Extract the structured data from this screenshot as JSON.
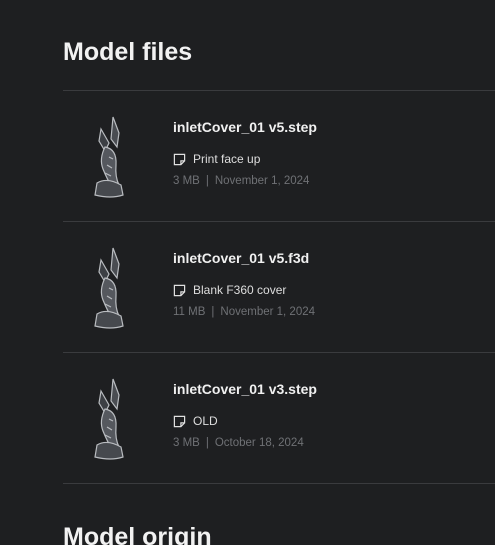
{
  "sections": {
    "files_title": "Model files",
    "origin_title": "Model origin"
  },
  "files": [
    {
      "name": "inletCover_01 v5.step",
      "note": "Print face up",
      "size": "3 MB",
      "separator": "|",
      "date": "November 1, 2024",
      "icon": "note-icon",
      "thumbnail": "model-thumbnail-icon"
    },
    {
      "name": "inletCover_01 v5.f3d",
      "note": "Blank F360 cover",
      "size": "11 MB",
      "separator": "|",
      "date": "November 1, 2024",
      "icon": "note-icon",
      "thumbnail": "model-thumbnail-icon"
    },
    {
      "name": "inletCover_01 v3.step",
      "note": "OLD",
      "size": "3 MB",
      "separator": "|",
      "date": "October 18, 2024",
      "icon": "note-icon",
      "thumbnail": "model-thumbnail-icon"
    }
  ],
  "colors": {
    "background": "#1e1f21",
    "divider": "#3a3b3e",
    "meta_text": "#6f7175"
  }
}
